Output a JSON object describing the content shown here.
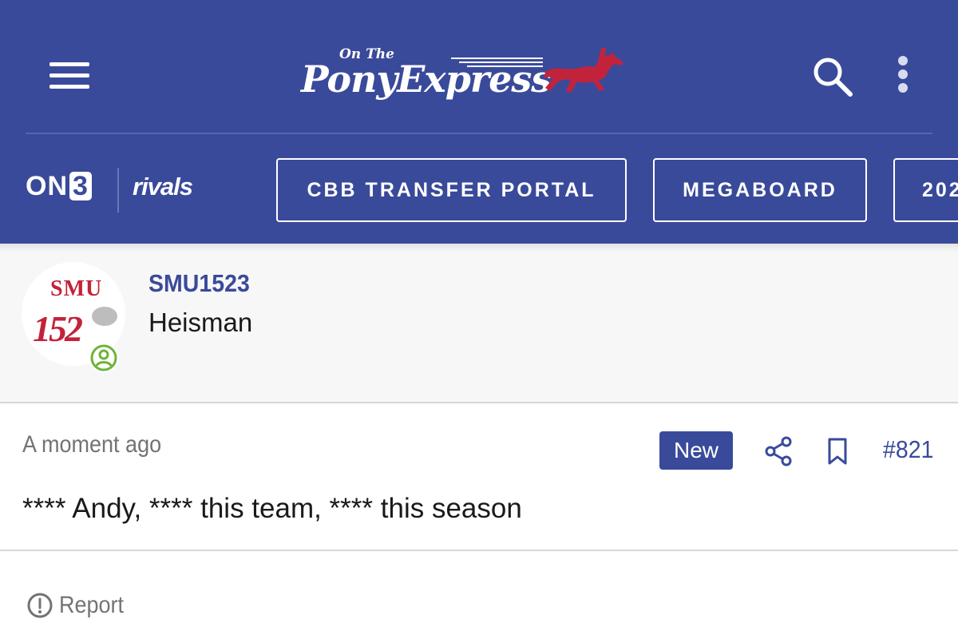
{
  "header": {
    "logo": {
      "line1": "On The",
      "line2": "PonyExpress"
    },
    "brands": {
      "on3_prefix": "ON",
      "on3_suffix": "3",
      "rivals": "rivals"
    },
    "nav_pills": [
      "CBB TRANSFER PORTAL",
      "MEGABOARD",
      "202"
    ]
  },
  "user": {
    "avatar_text": {
      "top": "SMU",
      "bottom": "152"
    },
    "username": "SMU1523",
    "title": "Heisman",
    "status": "online"
  },
  "post": {
    "timestamp": "A moment ago",
    "badge": "New",
    "number": "#821",
    "body": "**** Andy, **** this team, **** this season"
  },
  "footer": {
    "report_label": "Report"
  },
  "colors": {
    "brand_blue": "#3a4a9a",
    "brand_red": "#c3233a",
    "online_green": "#6fb33a",
    "muted_text": "#737373"
  },
  "icons": [
    "menu-icon",
    "search-icon",
    "more-vert-icon",
    "horse-icon",
    "share-icon",
    "bookmark-icon",
    "info-icon",
    "user-online-icon"
  ]
}
